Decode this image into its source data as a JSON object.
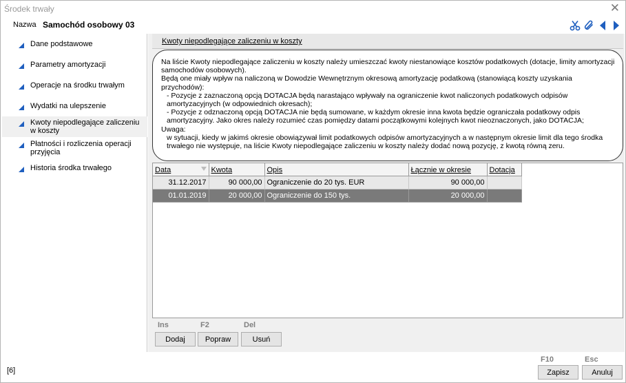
{
  "window": {
    "title": "Środek trwały",
    "close_glyph": "✕"
  },
  "header": {
    "name_label": "Nazwa",
    "name_value": "Samochód osobowy 03",
    "icons": [
      "scissors-icon",
      "paperclip-icon",
      "arrow-left-icon",
      "arrow-right-icon"
    ],
    "icon_color": "#1f5fbf"
  },
  "sidebar": {
    "items": [
      {
        "label": "Dane podstawowe"
      },
      {
        "label": "Parametry amortyzacji"
      },
      {
        "label": "Operacje na środku trwałym"
      },
      {
        "label": "Wydatki na ulepszenie"
      },
      {
        "label": "Kwoty niepodlegające zaliczeniu w koszty"
      },
      {
        "label": "Płatności i rozliczenia operacji przyjęcia"
      },
      {
        "label": "Historia środka trwałego"
      }
    ],
    "active_index": 4,
    "bullet_color": "#1f5fbf"
  },
  "section": {
    "title": "Kwoty niepodlegające zaliczeniu w koszty"
  },
  "info": {
    "p1": "Na liście Kwoty niepodlegające zaliczeniu w koszty należy umieszczać kwoty niestanowiące kosztów podatkowych (dotacje, limity amortyzacji samochodów osobowych).",
    "p2": "Będą one miały wpływ na naliczoną w Dowodzie Wewnętrznym okresową amortyzację podatkową (stanowiącą koszty uzyskania przychodów):",
    "p3": "- Pozycje z zaznaczoną opcją DOTACJA będą narastająco wpływały na ograniczenie kwot naliczonych podatkowych odpisów amortyzacyjnych (w odpowiednich okresach);",
    "p4": "- Pozycje z odznaczoną opcją DOTACJA nie będą sumowane, w każdym okresie inna kwota będzie ograniczała podatkowy odpis amortyzacyjny. Jako okres należy rozumieć czas pomiędzy datami początkowymi kolejnych kwot nieoznaczonych, jako DOTACJA;",
    "p5": "Uwaga:",
    "p6": "w sytuacji, kiedy w jakimś okresie obowiązywał limit podatkowych odpisów amortyzacyjnych a w następnym okresie limit dla tego środka trwałego nie występuje, na liście Kwoty niepodlegające zaliczeniu w koszty należy dodać nową pozycję, z kwotą równą zeru."
  },
  "table": {
    "columns": [
      "Data",
      "Kwota",
      "Opis",
      "Łącznie w okresie",
      "Dotacja"
    ],
    "rows": [
      {
        "data": "31.12.2017",
        "kwota": "90 000,00",
        "opis": "Ograniczenie do 20 tys. EUR",
        "lacznie": "90 000,00",
        "dotacja": ""
      },
      {
        "data": "01.01.2019",
        "kwota": "20 000,00",
        "opis": "Ograniczenie do 150 tys.",
        "lacznie": "20 000,00",
        "dotacja": ""
      }
    ],
    "selected_row": 1
  },
  "actions": {
    "add": {
      "shortcut": "Ins",
      "label": "Dodaj"
    },
    "edit": {
      "shortcut": "F2",
      "label": "Popraw"
    },
    "delete": {
      "shortcut": "Del",
      "label": "Usuń"
    }
  },
  "footer": {
    "status": "[6]",
    "save": {
      "shortcut": "F10",
      "label": "Zapisz"
    },
    "cancel": {
      "shortcut": "Esc",
      "label": "Anuluj"
    }
  }
}
